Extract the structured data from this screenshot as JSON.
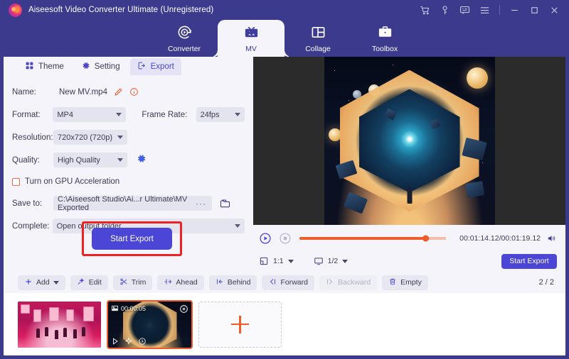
{
  "window": {
    "title": "Aiseesoft Video Converter Ultimate (Unregistered)",
    "logo_icon": "aiseesoft-logo-icon",
    "controls": [
      {
        "name": "cart-icon",
        "label": "Cart"
      },
      {
        "name": "key-icon",
        "label": "Register"
      },
      {
        "name": "feedback-icon",
        "label": "Feedback"
      },
      {
        "name": "menu-icon",
        "label": "Menu"
      },
      {
        "name": "minimize-icon",
        "label": "Minimize"
      },
      {
        "name": "maximize-icon",
        "label": "Maximize"
      },
      {
        "name": "close-icon",
        "label": "Close"
      }
    ]
  },
  "nav": {
    "tabs": [
      {
        "label": "Converter",
        "icon": "converter-icon",
        "active": false
      },
      {
        "label": "MV",
        "icon": "mv-icon",
        "active": true
      },
      {
        "label": "Collage",
        "icon": "collage-icon",
        "active": false
      },
      {
        "label": "Toolbox",
        "icon": "toolbox-icon",
        "active": false
      }
    ]
  },
  "subtabs": [
    {
      "label": "Theme",
      "icon": "grid-icon",
      "active": false
    },
    {
      "label": "Setting",
      "icon": "gear-icon",
      "active": false
    },
    {
      "label": "Export",
      "icon": "export-icon",
      "active": true
    }
  ],
  "form": {
    "name_label": "Name:",
    "name_value": "New MV.mp4",
    "edit_icon": "pencil-icon",
    "info_icon": "info-icon",
    "format_label": "Format:",
    "format_value": "MP4",
    "frame_rate_label": "Frame Rate:",
    "frame_rate_value": "24fps",
    "resolution_label": "Resolution:",
    "resolution_value": "720x720 (720p)",
    "quality_label": "Quality:",
    "quality_value": "High Quality",
    "quality_settings_icon": "gear-icon",
    "gpu_label": "Turn on GPU Acceleration",
    "gpu_checked": false,
    "save_to_label": "Save to:",
    "save_to_value": "C:\\Aiseesoft Studio\\Ai...r Ultimate\\MV Exported",
    "browse_dots": "···",
    "folder_icon": "folder-icon",
    "complete_label": "Complete:",
    "complete_value": "Open output folder"
  },
  "export_button": {
    "label": "Start Export",
    "highlight_color": "#ee2222"
  },
  "player": {
    "play_icon": "play-circle-icon",
    "stop_icon": "stop-circle-icon",
    "timecode": "00:01:14.12/00:01:19.12",
    "current_time": "00:01:14.12",
    "total_time": "00:01:19.12",
    "progress_percent": 88,
    "volume_icon": "volume-icon",
    "aspect_icon": "aspect-ratio-icon",
    "aspect_value": "1:1",
    "zoom_icon": "monitor-icon",
    "zoom_value": "1/2",
    "export_label": "Start Export"
  },
  "toolbar": {
    "buttons": [
      {
        "label": "Add",
        "icon": "plus-icon",
        "has_caret": true,
        "disabled": false
      },
      {
        "label": "Edit",
        "icon": "magic-wand-icon",
        "has_caret": false,
        "disabled": false
      },
      {
        "label": "Trim",
        "icon": "scissors-icon",
        "has_caret": false,
        "disabled": false
      },
      {
        "label": "Ahead",
        "icon": "insert-ahead-icon",
        "has_caret": false,
        "disabled": false
      },
      {
        "label": "Behind",
        "icon": "insert-behind-icon",
        "has_caret": false,
        "disabled": false
      },
      {
        "label": "Forward",
        "icon": "move-forward-icon",
        "has_caret": false,
        "disabled": false
      },
      {
        "label": "Backward",
        "icon": "move-backward-icon",
        "has_caret": false,
        "disabled": true
      },
      {
        "label": "Empty",
        "icon": "trash-icon",
        "has_caret": false,
        "disabled": false
      }
    ],
    "pager": "2 / 2"
  },
  "thumbnails": {
    "items": [
      {
        "name": "clip-gallery",
        "duration": "",
        "selected": false
      },
      {
        "name": "clip-space-portal",
        "duration": "00:00:05",
        "selected": true
      }
    ],
    "add_label": "+",
    "close_icon": "close-circle-icon",
    "image_icon": "image-icon",
    "play_icon": "play-icon",
    "effects_icon": "star-effects-icon",
    "duration_icon": "clock-icon"
  },
  "colors": {
    "brand_purple": "#3b3a8c",
    "accent_blue": "#4b46d6",
    "accent_orange": "#f15a2b",
    "panel_bg": "#f4f4fa",
    "field_bg": "#e4e4ef",
    "highlight_red": "#ee2222"
  }
}
